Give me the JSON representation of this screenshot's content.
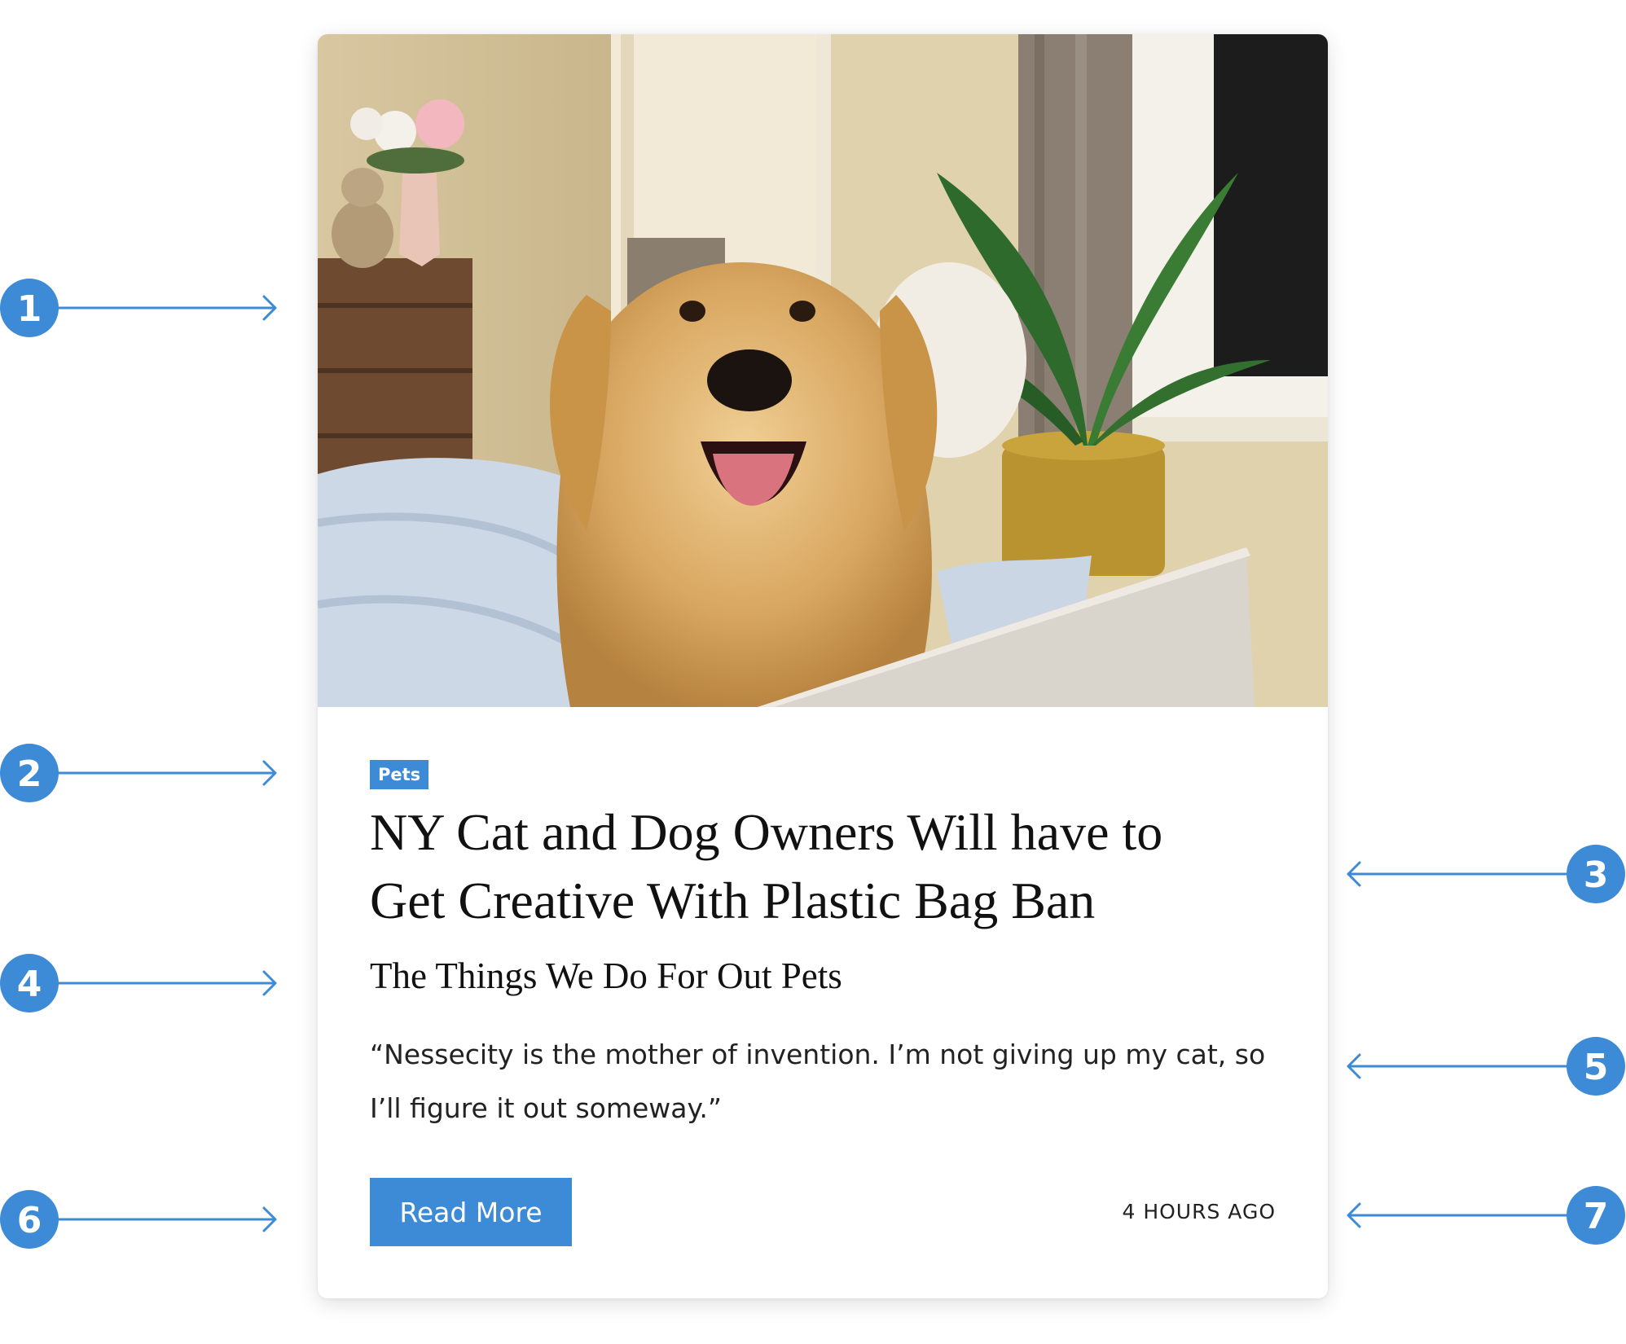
{
  "card": {
    "category": "Pets",
    "headline_line1": "NY Cat and Dog Owners Will have to",
    "headline_line2": "Get Creative With Plastic Bag Ban",
    "subheadline": "The Things We Do For Out Pets",
    "quote": "“Nessecity is the mother of invention. I’m not giving up my cat, so I’ll figure it out someway.”",
    "button_label": "Read More",
    "timestamp": "4 HOURS AGO"
  },
  "callouts": [
    "1",
    "2",
    "3",
    "4",
    "5",
    "6",
    "7"
  ],
  "colors": {
    "accent": "#3d8ad6",
    "text": "#111111"
  }
}
